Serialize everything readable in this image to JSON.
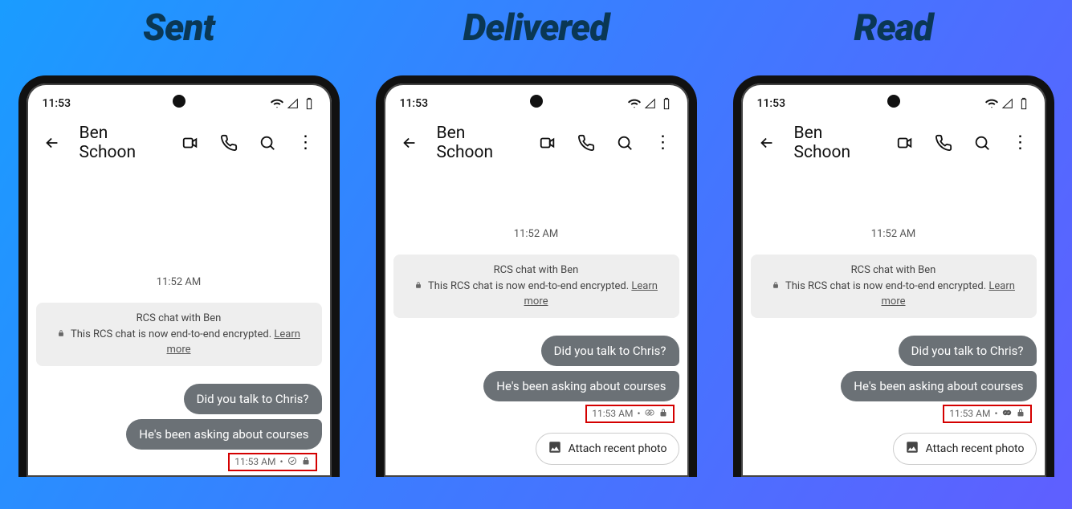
{
  "columns": [
    {
      "title": "Sent",
      "spacer": "high",
      "status_icon": "single",
      "show_attach": false
    },
    {
      "title": "Delivered",
      "spacer": "low",
      "status_icon": "double",
      "show_attach": true
    },
    {
      "title": "Read",
      "spacer": "low",
      "status_icon": "double-filled",
      "show_attach": true
    }
  ],
  "status_time": "11:53",
  "contact_name": "Ben Schoon",
  "conv_time": "11:52 AM",
  "banner_line1": "RCS chat with Ben",
  "banner_line2": "This RCS chat is now end-to-end encrypted.",
  "banner_learn": "Learn more",
  "msg1": "Did you talk to Chris?",
  "msg2": "He's been asking about courses",
  "meta_time": "11:53 AM",
  "attach_label": "Attach recent photo"
}
